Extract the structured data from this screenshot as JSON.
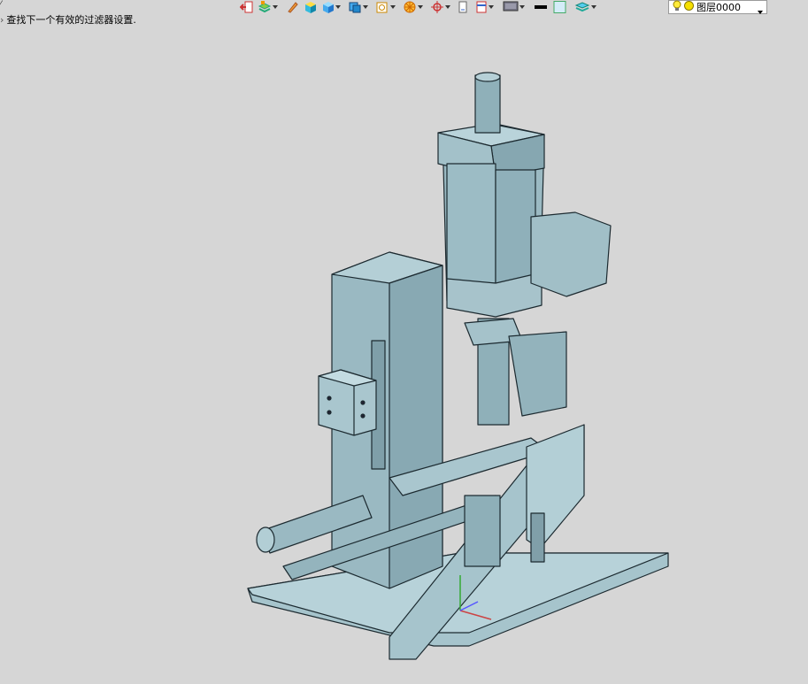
{
  "toolbar": {
    "items": [
      {
        "icon": "exit-icon"
      },
      {
        "icon": "layer-stack-icon"
      },
      {
        "icon": "pencil-icon"
      },
      {
        "icon": "cube-yellow-icon"
      },
      {
        "icon": "cube-blue-icon"
      },
      {
        "icon": "cube-solid-icon"
      },
      {
        "icon": "sketch-orange-icon"
      },
      {
        "icon": "wheel-icon"
      },
      {
        "icon": "crosshair-icon"
      },
      {
        "icon": "page-icon"
      },
      {
        "icon": "ruler-icon"
      },
      {
        "icon": "display-icon"
      },
      {
        "icon": "color-swatch-black-icon"
      },
      {
        "icon": "color-swatch-lightblue-icon"
      },
      {
        "icon": "layers-icon"
      }
    ],
    "layer_select": {
      "value": "图层0000",
      "bulb_icon": "lightbulb-icon",
      "state_icon": "sun-icon"
    }
  },
  "status": {
    "message": "查找下一个有效的过滤器设置."
  },
  "colors": {
    "background": "#d6d6d6",
    "model_fill": "#9fbfc7",
    "model_edge": "#1c2a30"
  }
}
